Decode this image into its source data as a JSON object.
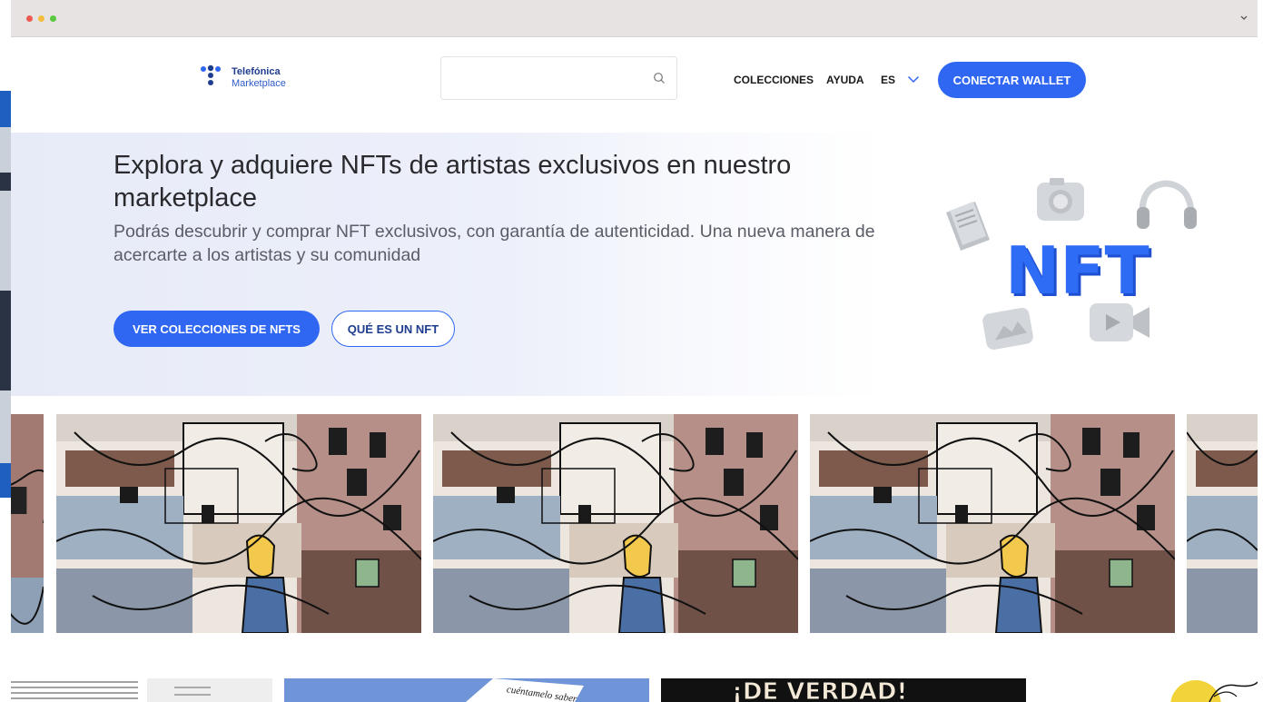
{
  "header": {
    "logo_line1": "Telefónica",
    "logo_line2": "Marketplace",
    "search_placeholder": "",
    "nav": {
      "collections": "COLECCIONES",
      "help": "AYUDA",
      "language": "ES"
    },
    "connect_wallet": "CONECTAR WALLET"
  },
  "hero": {
    "title": "Explora y adquiere NFTs de artistas exclusivos en nuestro marketplace",
    "subtitle": "Podrás descubrir y comprar NFT exclusivos, con garantía de autenticidad. Una nueva manera de acercarte a los artistas y su comunidad",
    "primary_button": "VER COLECCIONES DE NFTS",
    "secondary_button": "QUÉ ES UN NFT",
    "illustration_text": "NFT"
  },
  "bottom_thumbs": {
    "handwritten": "cuéntamelo saber",
    "poster_text": "¡DE VERDAD!"
  },
  "colors": {
    "brand_blue": "#2f67f2",
    "logo_navy": "#1f3d8f",
    "title_text": "#2a2a2e",
    "subtitle_text": "#5a5c66"
  },
  "icons": [
    "search-icon",
    "chevron-down-icon",
    "telefonica-logo-icon"
  ]
}
